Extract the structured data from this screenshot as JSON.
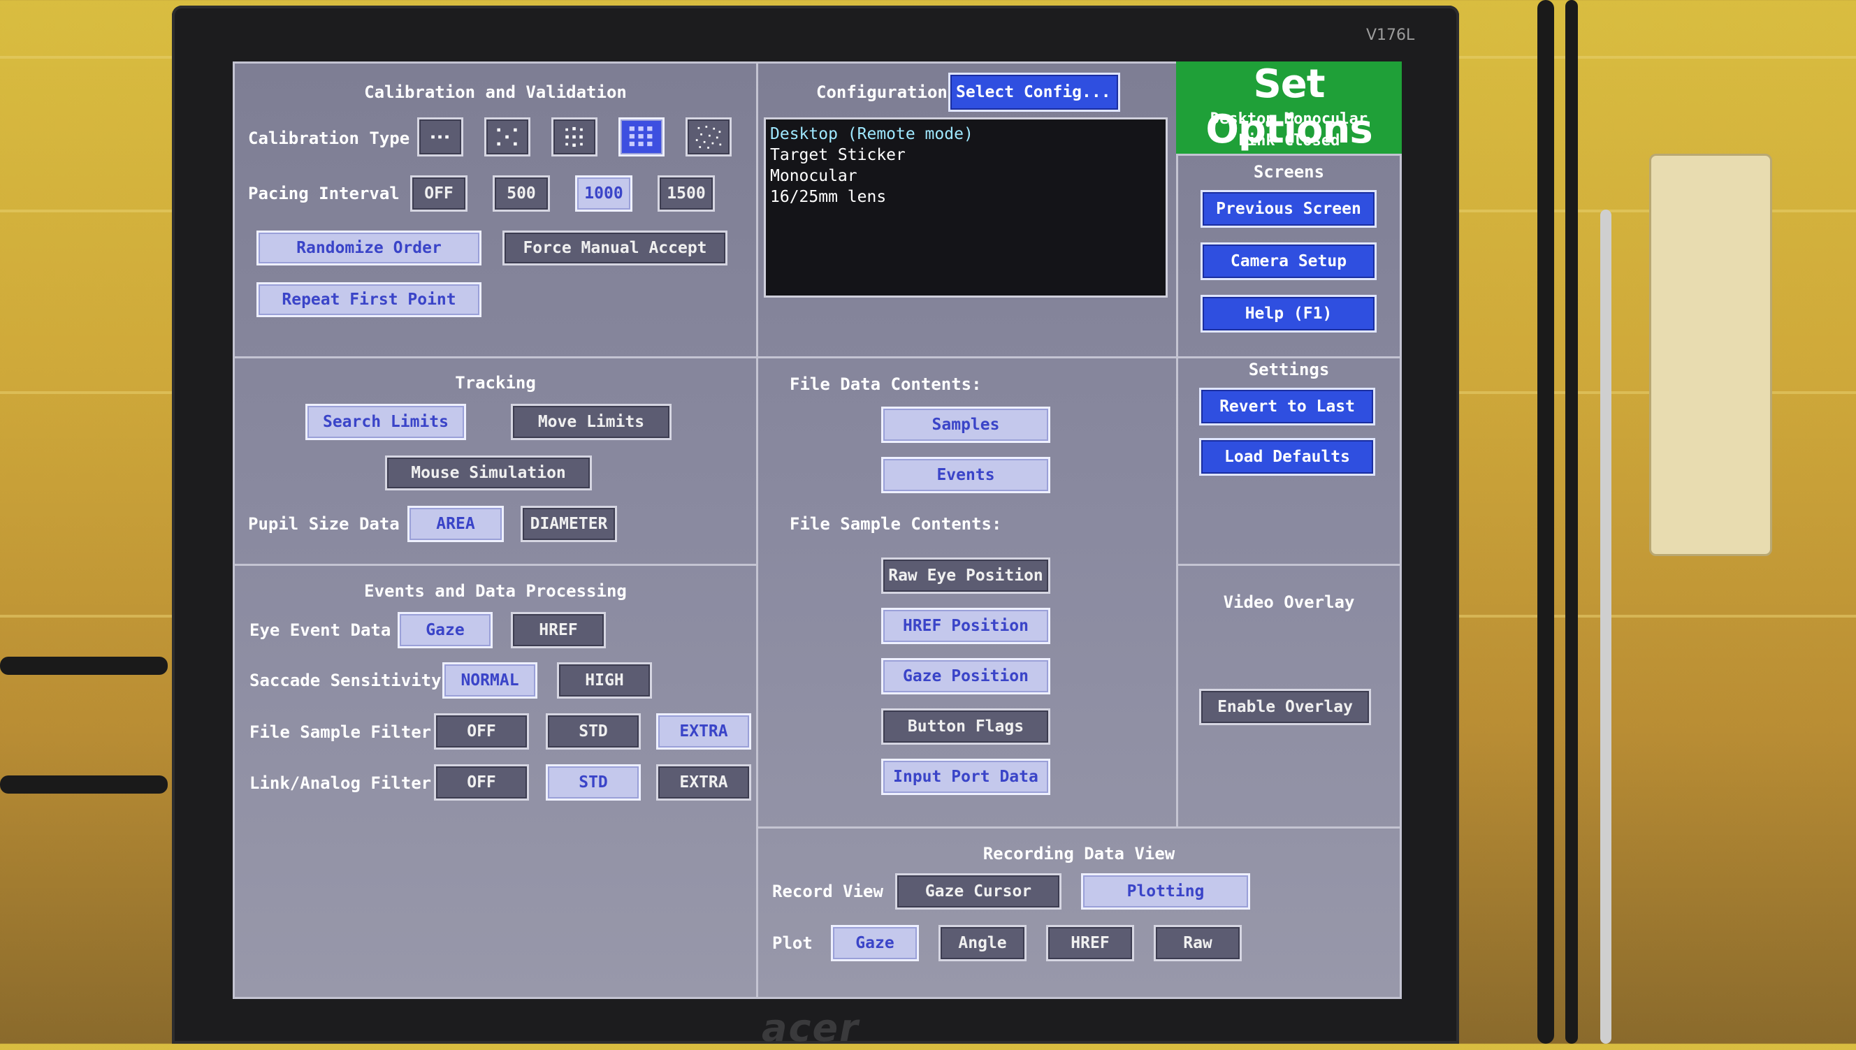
{
  "monitor": {
    "model": "V176L",
    "brand": "acer"
  },
  "header": {
    "title": "Set Options",
    "status_line1": "Desktop Monocular",
    "status_line2": "Link Closed"
  },
  "calibration": {
    "heading": "Calibration and Validation",
    "type_label": "Calibration Type",
    "type_options": [
      "3-point",
      "5-point",
      "9-point",
      "13-point",
      "random"
    ],
    "type_selected": "13-point",
    "pacing_label": "Pacing Interval",
    "pacing_options": [
      "OFF",
      "500",
      "1000",
      "1500"
    ],
    "pacing_selected": "1000",
    "randomize_order": "Randomize Order",
    "force_manual_accept": "Force Manual Accept",
    "repeat_first_point": "Repeat First Point"
  },
  "configuration": {
    "label": "Configuration:",
    "select_button": "Select  Config...",
    "lines": [
      "Desktop (Remote mode)",
      "Target Sticker",
      "Monocular",
      "16/25mm lens"
    ]
  },
  "screens": {
    "heading": "Screens",
    "previous_screen": "Previous Screen",
    "camera_setup": "Camera Setup",
    "help": "Help (F1)"
  },
  "settings": {
    "heading": "Settings",
    "revert_to_last": "Revert to Last",
    "load_defaults": "Load Defaults"
  },
  "tracking": {
    "heading": "Tracking",
    "search_limits": "Search Limits",
    "move_limits": "Move Limits",
    "mouse_simulation": "Mouse Simulation",
    "pupil_label": "Pupil Size Data",
    "pupil_area": "AREA",
    "pupil_diameter": "DIAMETER"
  },
  "file_data": {
    "contents_heading": "File Data Contents:",
    "samples": "Samples",
    "events": "Events",
    "sample_heading": "File Sample Contents:",
    "raw_eye": "Raw Eye Position",
    "href_position": "HREF Position",
    "gaze_position": "Gaze Position",
    "button_flags": "Button Flags",
    "input_port": "Input Port Data"
  },
  "events_processing": {
    "heading": "Events and Data Processing",
    "eye_event_label": "Eye Event Data",
    "gaze": "Gaze",
    "href": "HREF",
    "saccade_label": "Saccade Sensitivity",
    "normal": "NORMAL",
    "high": "HIGH",
    "file_filter_label": "File Sample Filter",
    "link_filter_label": "Link/Analog Filter",
    "filter_off": "OFF",
    "filter_std": "STD",
    "filter_extra": "EXTRA"
  },
  "video_overlay": {
    "heading": "Video Overlay",
    "enable": "Enable Overlay"
  },
  "recording": {
    "heading": "Recording Data View",
    "record_view_label": "Record View",
    "gaze_cursor": "Gaze Cursor",
    "plotting": "Plotting",
    "plot_label": "Plot",
    "plot_gaze": "Gaze",
    "plot_angle": "Angle",
    "plot_href": "HREF",
    "plot_raw": "Raw"
  },
  "colors": {
    "screen_bg": "#86869c",
    "title_green": "#1fa038",
    "button_blue": "#2f4fe0",
    "selected_light": "#c4c8ec"
  }
}
